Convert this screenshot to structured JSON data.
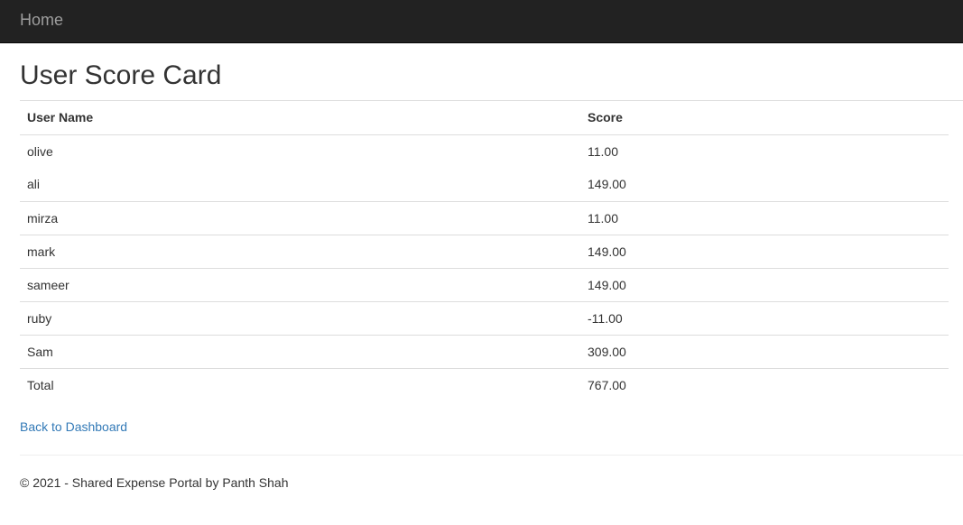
{
  "nav": {
    "brand": "Home"
  },
  "page_title": "User Score Card",
  "table": {
    "headers": [
      "User Name",
      "Score"
    ],
    "rows": [
      [
        "olive",
        "11.00"
      ],
      [
        "ali",
        "149.00"
      ],
      [
        "mirza",
        "11.00"
      ],
      [
        "mark",
        "149.00"
      ],
      [
        "sameer",
        "149.00"
      ],
      [
        "ruby",
        "-11.00"
      ],
      [
        "Sam",
        "309.00"
      ],
      [
        "Total",
        "767.00"
      ]
    ]
  },
  "back_link": "Back to Dashboard",
  "footer": "© 2021 - Shared Expense Portal by Panth Shah"
}
